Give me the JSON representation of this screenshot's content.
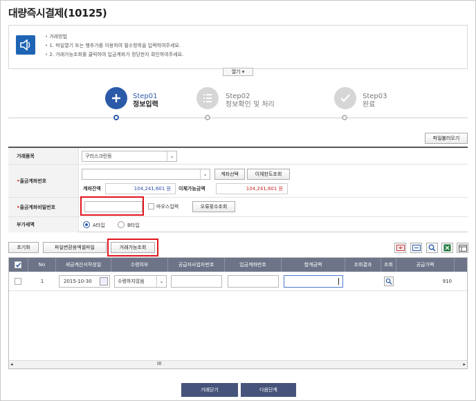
{
  "page": {
    "title": "대량즉시결제(10125)"
  },
  "notice": {
    "lines": [
      "거래방법",
      "1. 파일열기 또는 행추가를 이용하여 필수항목을 입력하여주세요.",
      "2. 거래가능조회를 클릭하여 입금계좌가 정당한지 확인하여주세요."
    ],
    "open_label": "열기 ▾"
  },
  "steps": [
    {
      "num": "Step01",
      "name": "정보입력",
      "active": true
    },
    {
      "num": "Step02",
      "name": "정보확인 및 처리",
      "active": false
    },
    {
      "num": "Step03",
      "name": "완료",
      "active": false
    }
  ],
  "form": {
    "load_file_label": "파일불러오기",
    "trade_item_label": "거래품목",
    "trade_item_value": "구리스크린등",
    "account_label": "출금계좌번호",
    "account_value": "",
    "select_account_label": "계좌선택",
    "transfer_limit_label": "이체한도조회",
    "balance_label": "계좌잔액",
    "balance_value": "104,241,601 원",
    "available_label": "이체가능금액",
    "available_value": "104,241,601 원",
    "password_label": "출금계좌비밀번호",
    "password_value": "",
    "mouse_input_label": "마우스입력",
    "error_count_label": "오류횟수조회",
    "tax_label": "부가세액",
    "tax_option_a": "A타입",
    "tax_option_b": "B타입"
  },
  "actions": {
    "reset_label": "초기화",
    "file_convert_label": "파일변환용엑셀파일",
    "check_label": "거래가능조회"
  },
  "grid": {
    "headers": [
      "No",
      "세금계산서작성일",
      "수령여부",
      "공급자사업자번호",
      "입금계좌번호",
      "합계금액",
      "조회결과",
      "조회",
      "공급가액"
    ],
    "rows": [
      {
        "no": "1",
        "date": "2015-10-30",
        "receive": "수령하지않음",
        "supplier": "",
        "account": "",
        "total": "",
        "result": "",
        "supply": "910"
      }
    ],
    "scroll_glyph": "III"
  },
  "bottom": {
    "prev_label": "거래닫기",
    "next_label": "다음단계"
  },
  "colors": {
    "accent": "#2a5aa8",
    "highlight": "#e0141e",
    "header_bg": "#6d7488"
  }
}
